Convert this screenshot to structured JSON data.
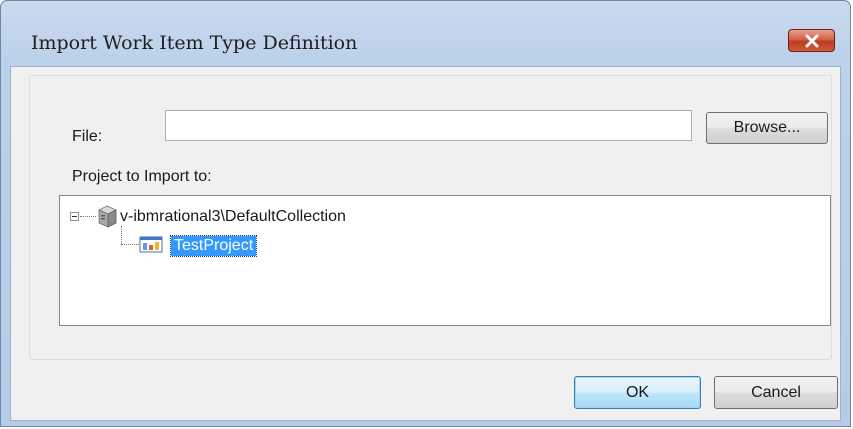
{
  "window": {
    "title": "Import Work Item Type Definition",
    "close_icon": "close-icon"
  },
  "form": {
    "file_label": "File:",
    "file_value": "",
    "browse_label": "Browse...",
    "project_label": "Project to Import to:"
  },
  "tree": {
    "root": {
      "label": "v-ibmrational3\\DefaultCollection",
      "icon": "server-icon",
      "expanded": true
    },
    "children": [
      {
        "label": "TestProject",
        "icon": "team-project-icon",
        "selected": true
      }
    ]
  },
  "buttons": {
    "ok_label": "OK",
    "cancel_label": "Cancel"
  },
  "colors": {
    "selection": "#3399ff",
    "close_button": "#c8452b"
  }
}
